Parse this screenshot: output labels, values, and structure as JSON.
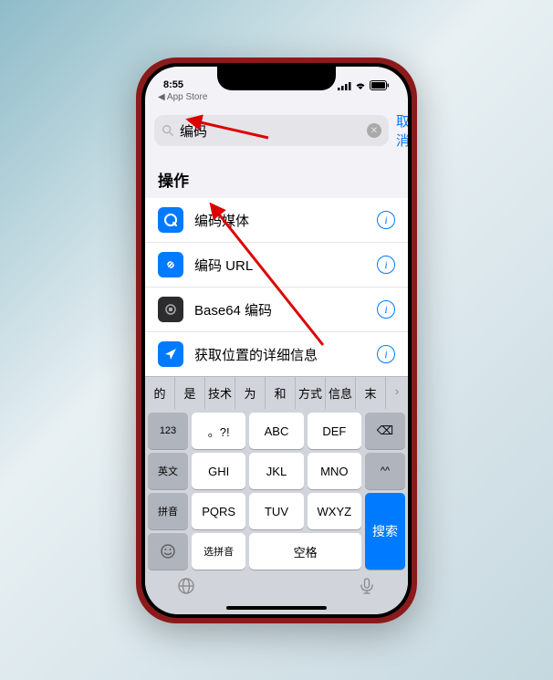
{
  "status": {
    "time": "8:55",
    "back_app": "◀ App Store"
  },
  "search": {
    "value": "编码",
    "cancel": "取消"
  },
  "section": {
    "title": "操作"
  },
  "items": [
    {
      "icon": "quicktime",
      "label": "编码媒体",
      "color": "blue"
    },
    {
      "icon": "link",
      "label": "编码 URL",
      "color": "blue"
    },
    {
      "icon": "base64",
      "label": "Base64 编码",
      "color": "dark"
    },
    {
      "icon": "location",
      "label": "获取位置的详细信息",
      "color": "blue"
    }
  ],
  "candidates": [
    "的",
    "是",
    "技术",
    "为",
    "和",
    "方式",
    "信息",
    "末",
    "›"
  ],
  "keyboard": {
    "r1": [
      "123",
      "。?!",
      "ABC",
      "DEF"
    ],
    "r2": [
      "英文",
      "GHI",
      "JKL",
      "MNO"
    ],
    "r3": [
      "拼音",
      "PQRS",
      "TUV",
      "WXYZ"
    ],
    "r4": [
      "选拼音",
      "空格"
    ],
    "backspace": "⌫",
    "smile": "^^",
    "search": "搜索",
    "globe": "🌐",
    "mic": "🎤"
  }
}
